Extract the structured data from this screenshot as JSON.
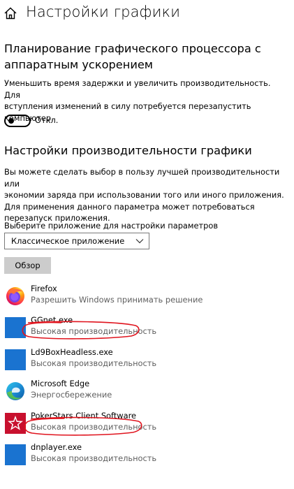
{
  "header": {
    "title": "Настройки графики",
    "home_icon": "home-icon"
  },
  "gpu_scheduling": {
    "title_line1": "Планирование графического процессора с",
    "title_line2": "аппаратным ускорением",
    "desc_line1": "Уменьшить время задержки и увеличить производительность. Для",
    "desc_line2": "вступления изменений в силу потребуется перезапустить",
    "desc_line3": "компьютер.",
    "toggle_state": "off",
    "toggle_label": "Откл."
  },
  "perf_settings": {
    "title": "Настройки производительности графики",
    "desc_line1": "Вы можете сделать выбор в пользу лучшей производительности или",
    "desc_line2": "экономии заряда при использовании того или иного приложения.",
    "desc_line3": "Для применения данного параметра может потребоваться",
    "desc_line4": "перезапуск приложения.",
    "select_label": "Выберите приложение для настройки параметров",
    "select_value": "Классическое приложение",
    "browse_label": "Обзор"
  },
  "apps": [
    {
      "name": "Firefox",
      "setting": "Разрешить Windows принимать решение",
      "icon": "firefox-icon"
    },
    {
      "name": "GGnet.exe",
      "setting": "Высокая производительность",
      "icon": "generic-app-icon"
    },
    {
      "name": "Ld9BoxHeadless.exe",
      "setting": "Высокая производительность",
      "icon": "generic-app-icon"
    },
    {
      "name": "Microsoft Edge",
      "setting": "Энергосбережение",
      "icon": "edge-icon"
    },
    {
      "name": "PokerStars Client Software",
      "setting": "Высокая производительность",
      "icon": "pokerstars-icon"
    },
    {
      "name": "dnplayer.exe",
      "setting": "Высокая производительность",
      "icon": "generic-app-icon"
    }
  ],
  "colors": {
    "app_icon_blue": "#1a73d0",
    "annotation_red": "#e0141e",
    "button_gray": "#cccccc"
  }
}
